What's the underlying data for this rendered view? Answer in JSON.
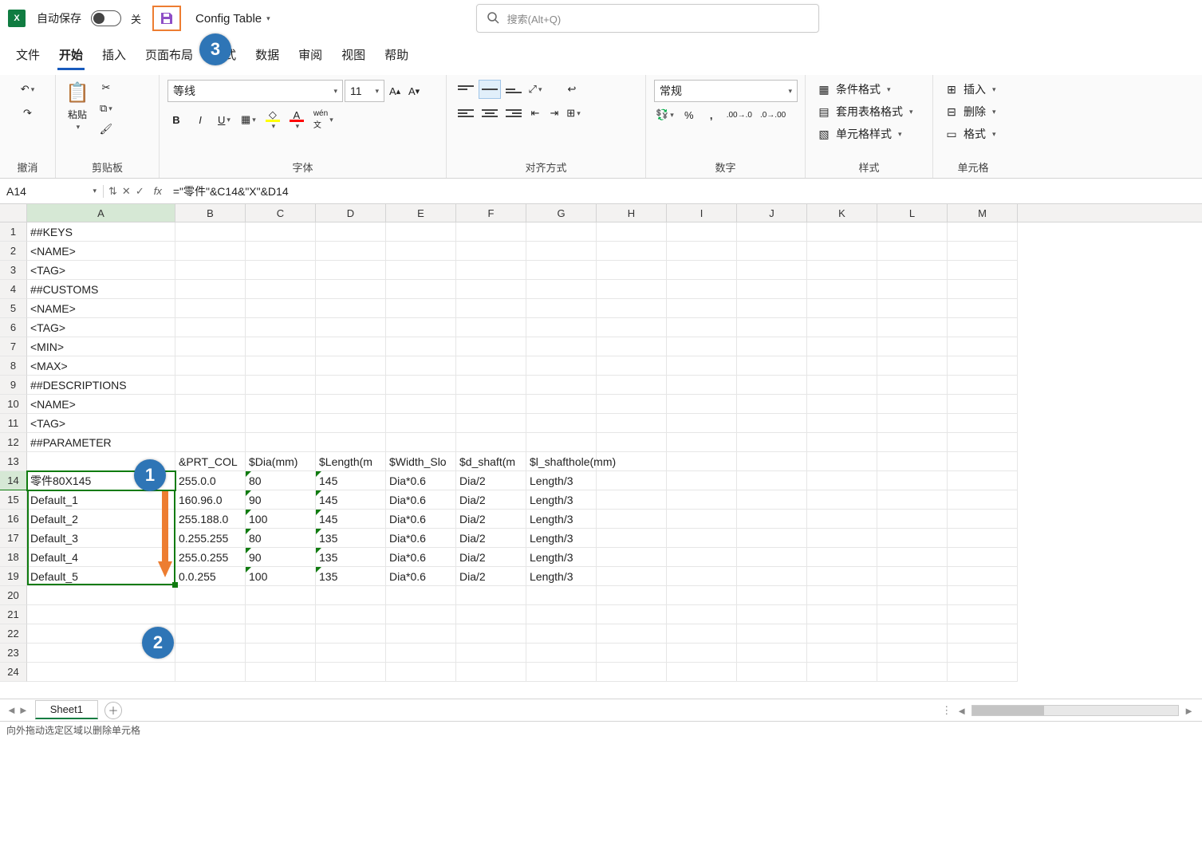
{
  "titlebar": {
    "autosave": "自动保存",
    "off": "关",
    "filename": "Config Table",
    "search_placeholder": "搜索(Alt+Q)"
  },
  "tabs": {
    "file": "文件",
    "home": "开始",
    "insert": "插入",
    "pagelayout": "页面布局",
    "formulas": "公式",
    "data": "数据",
    "review": "审阅",
    "view": "视图",
    "help": "帮助"
  },
  "ribbon": {
    "undo_group": "撤消",
    "clipboard_group": "剪贴板",
    "paste": "粘贴",
    "font_group": "字体",
    "fontname": "等线",
    "fontsize": "11",
    "alignment_group": "对齐方式",
    "number_group": "数字",
    "number_format": "常规",
    "styles_group": "样式",
    "cond_fmt": "条件格式",
    "table_fmt": "套用表格格式",
    "cell_style": "单元格样式",
    "cells_group": "单元格",
    "insert_cells": "插入",
    "delete_cells": "删除",
    "format_cells": "格式"
  },
  "formulabar": {
    "namebox": "A14",
    "formula": "=\"零件\"&C14&\"X\"&D14"
  },
  "columns": [
    "A",
    "B",
    "C",
    "D",
    "E",
    "F",
    "G",
    "H",
    "I",
    "J",
    "K",
    "L",
    "M"
  ],
  "rows": [
    {
      "r": 1,
      "A": "##KEYS"
    },
    {
      "r": 2,
      "A": "<NAME>"
    },
    {
      "r": 3,
      "A": "<TAG>"
    },
    {
      "r": 4,
      "A": "##CUSTOMS"
    },
    {
      "r": 5,
      "A": "<NAME>"
    },
    {
      "r": 6,
      "A": "<TAG>"
    },
    {
      "r": 7,
      "A": "<MIN>"
    },
    {
      "r": 8,
      "A": "<MAX>"
    },
    {
      "r": 9,
      "A": "##DESCRIPTIONS"
    },
    {
      "r": 10,
      "A": "<NAME>"
    },
    {
      "r": 11,
      "A": "<TAG>"
    },
    {
      "r": 12,
      "A": "##PARAMETER"
    },
    {
      "r": 13,
      "A": "",
      "B": "&PRT_COL",
      "C": "$Dia(mm)",
      "D": "$Length(m",
      "E": "$Width_Slo",
      "F": "$d_shaft(m",
      "G": "$l_shafthole(mm)"
    },
    {
      "r": 14,
      "A": "零件80X145",
      "B": "255.0.0",
      "C": "80",
      "D": "145",
      "E": "Dia*0.6",
      "F": "Dia/2",
      "G": "Length/3",
      "sel": true
    },
    {
      "r": 15,
      "A": "Default_1",
      "B": "160.96.0",
      "C": "90",
      "D": "145",
      "E": "Dia*0.6",
      "F": "Dia/2",
      "G": "Length/3"
    },
    {
      "r": 16,
      "A": "Default_2",
      "B": "255.188.0",
      "C": "100",
      "D": "145",
      "E": "Dia*0.6",
      "F": "Dia/2",
      "G": "Length/3"
    },
    {
      "r": 17,
      "A": "Default_3",
      "B": "0.255.255",
      "C": "80",
      "D": "135",
      "E": "Dia*0.6",
      "F": "Dia/2",
      "G": "Length/3"
    },
    {
      "r": 18,
      "A": "Default_4",
      "B": "255.0.255",
      "C": "90",
      "D": "135",
      "E": "Dia*0.6",
      "F": "Dia/2",
      "G": "Length/3"
    },
    {
      "r": 19,
      "A": "Default_5",
      "B": "0.0.255",
      "C": "100",
      "D": "135",
      "E": "Dia*0.6",
      "F": "Dia/2",
      "G": "Length/3"
    },
    {
      "r": 20
    },
    {
      "r": 21
    },
    {
      "r": 22
    },
    {
      "r": 23
    },
    {
      "r": 24
    }
  ],
  "sheet": {
    "name": "Sheet1"
  },
  "status": "向外拖动选定区域以删除单元格",
  "callouts": {
    "c1": "1",
    "c2": "2",
    "c3": "3"
  }
}
